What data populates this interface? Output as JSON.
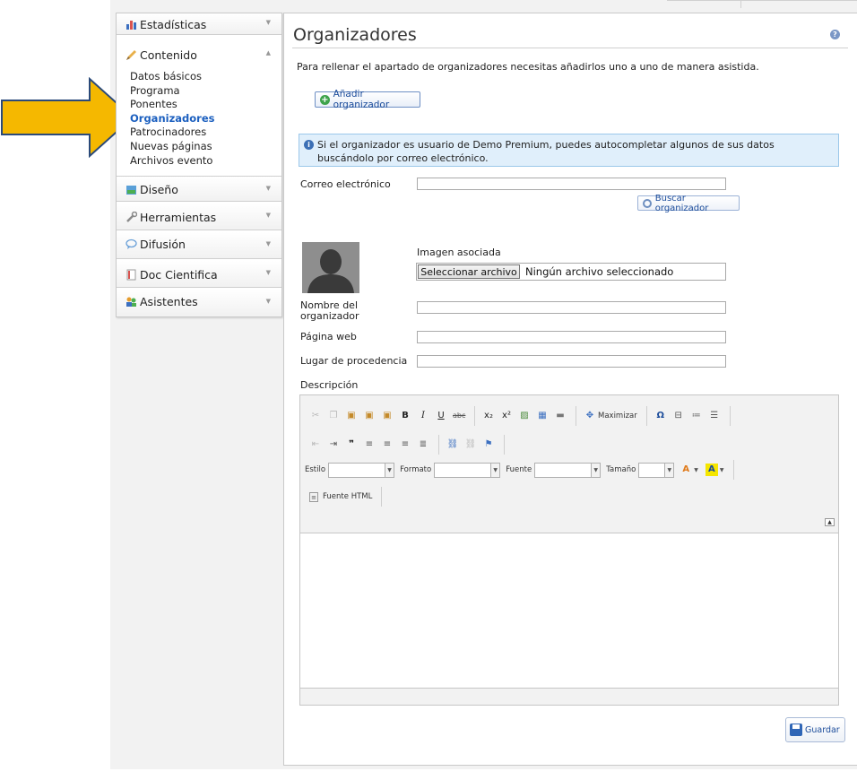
{
  "sidebar": {
    "sections": [
      {
        "label": "Estadísticas",
        "icon": "bar-chart-icon",
        "expanded": false
      },
      {
        "label": "Contenido",
        "icon": "pencil-icon",
        "expanded": true
      },
      {
        "label": "Diseño",
        "icon": "layout-icon",
        "expanded": false
      },
      {
        "label": "Herramientas",
        "icon": "wrench-icon",
        "expanded": false
      },
      {
        "label": "Difusión",
        "icon": "speech-bubble-icon",
        "expanded": false
      },
      {
        "label": "Doc Cientifica",
        "icon": "document-icon",
        "expanded": false
      },
      {
        "label": "Asistentes",
        "icon": "people-icon",
        "expanded": false
      }
    ],
    "content_links": [
      "Datos básicos",
      "Programa",
      "Ponentes",
      "Organizadores",
      "Patrocinadores",
      "Nuevas páginas",
      "Archivos evento"
    ],
    "active_link": "Organizadores"
  },
  "main": {
    "title": "Organizadores",
    "intro": "Para rellenar el apartado de organizadores necesitas añadirlos uno a uno de manera asistida.",
    "add_button": "Añadir organizador",
    "info": "Si el organizador es usuario de Demo Premium, puedes autocompletar algunos de sus datos buscándolo por correo electrónico.",
    "email_label": "Correo electrónico",
    "email_value": "",
    "search_button": "Buscar organizador",
    "image_label": "Imagen asociada",
    "file_button": "Seleccionar archivo",
    "file_status": "Ningún archivo seleccionado",
    "name_label": "Nombre del organizador",
    "name_value": "",
    "web_label": "Página web",
    "web_value": "",
    "origin_label": "Lugar de procedencia",
    "origin_value": "",
    "description_label": "Descripción",
    "save_button": "Guardar"
  },
  "editor": {
    "maximize_label": "Maximizar",
    "style_label": "Estilo",
    "format_label": "Formato",
    "font_label": "Fuente",
    "size_label": "Tamaño",
    "html_source_label": "Fuente HTML"
  },
  "colors": {
    "accent": "#1b5fbf",
    "arrow_fill": "#f5b800",
    "arrow_stroke": "#2b4a7a",
    "info_bg": "#e0effb"
  }
}
